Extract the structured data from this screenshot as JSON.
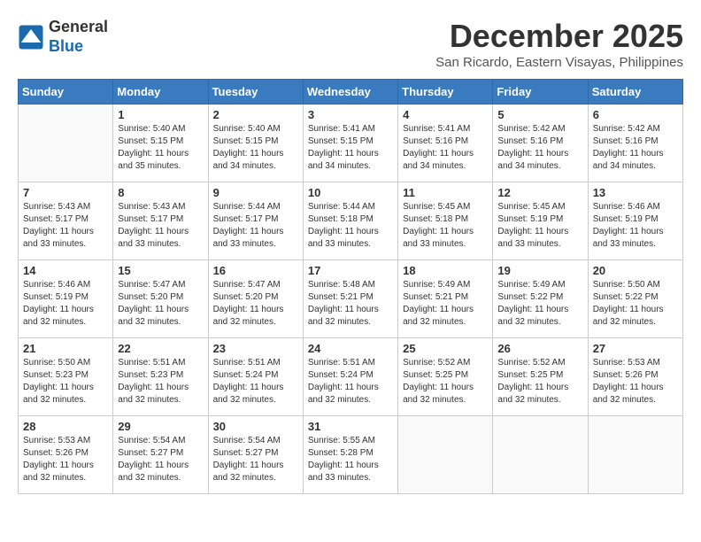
{
  "header": {
    "logo_line1": "General",
    "logo_line2": "Blue",
    "title": "December 2025",
    "subtitle": "San Ricardo, Eastern Visayas, Philippines"
  },
  "weekdays": [
    "Sunday",
    "Monday",
    "Tuesday",
    "Wednesday",
    "Thursday",
    "Friday",
    "Saturday"
  ],
  "weeks": [
    [
      {
        "day": "",
        "info": ""
      },
      {
        "day": "1",
        "info": "Sunrise: 5:40 AM\nSunset: 5:15 PM\nDaylight: 11 hours\nand 35 minutes."
      },
      {
        "day": "2",
        "info": "Sunrise: 5:40 AM\nSunset: 5:15 PM\nDaylight: 11 hours\nand 34 minutes."
      },
      {
        "day": "3",
        "info": "Sunrise: 5:41 AM\nSunset: 5:15 PM\nDaylight: 11 hours\nand 34 minutes."
      },
      {
        "day": "4",
        "info": "Sunrise: 5:41 AM\nSunset: 5:16 PM\nDaylight: 11 hours\nand 34 minutes."
      },
      {
        "day": "5",
        "info": "Sunrise: 5:42 AM\nSunset: 5:16 PM\nDaylight: 11 hours\nand 34 minutes."
      },
      {
        "day": "6",
        "info": "Sunrise: 5:42 AM\nSunset: 5:16 PM\nDaylight: 11 hours\nand 34 minutes."
      }
    ],
    [
      {
        "day": "7",
        "info": "Sunrise: 5:43 AM\nSunset: 5:17 PM\nDaylight: 11 hours\nand 33 minutes."
      },
      {
        "day": "8",
        "info": "Sunrise: 5:43 AM\nSunset: 5:17 PM\nDaylight: 11 hours\nand 33 minutes."
      },
      {
        "day": "9",
        "info": "Sunrise: 5:44 AM\nSunset: 5:17 PM\nDaylight: 11 hours\nand 33 minutes."
      },
      {
        "day": "10",
        "info": "Sunrise: 5:44 AM\nSunset: 5:18 PM\nDaylight: 11 hours\nand 33 minutes."
      },
      {
        "day": "11",
        "info": "Sunrise: 5:45 AM\nSunset: 5:18 PM\nDaylight: 11 hours\nand 33 minutes."
      },
      {
        "day": "12",
        "info": "Sunrise: 5:45 AM\nSunset: 5:19 PM\nDaylight: 11 hours\nand 33 minutes."
      },
      {
        "day": "13",
        "info": "Sunrise: 5:46 AM\nSunset: 5:19 PM\nDaylight: 11 hours\nand 33 minutes."
      }
    ],
    [
      {
        "day": "14",
        "info": "Sunrise: 5:46 AM\nSunset: 5:19 PM\nDaylight: 11 hours\nand 32 minutes."
      },
      {
        "day": "15",
        "info": "Sunrise: 5:47 AM\nSunset: 5:20 PM\nDaylight: 11 hours\nand 32 minutes."
      },
      {
        "day": "16",
        "info": "Sunrise: 5:47 AM\nSunset: 5:20 PM\nDaylight: 11 hours\nand 32 minutes."
      },
      {
        "day": "17",
        "info": "Sunrise: 5:48 AM\nSunset: 5:21 PM\nDaylight: 11 hours\nand 32 minutes."
      },
      {
        "day": "18",
        "info": "Sunrise: 5:49 AM\nSunset: 5:21 PM\nDaylight: 11 hours\nand 32 minutes."
      },
      {
        "day": "19",
        "info": "Sunrise: 5:49 AM\nSunset: 5:22 PM\nDaylight: 11 hours\nand 32 minutes."
      },
      {
        "day": "20",
        "info": "Sunrise: 5:50 AM\nSunset: 5:22 PM\nDaylight: 11 hours\nand 32 minutes."
      }
    ],
    [
      {
        "day": "21",
        "info": "Sunrise: 5:50 AM\nSunset: 5:23 PM\nDaylight: 11 hours\nand 32 minutes."
      },
      {
        "day": "22",
        "info": "Sunrise: 5:51 AM\nSunset: 5:23 PM\nDaylight: 11 hours\nand 32 minutes."
      },
      {
        "day": "23",
        "info": "Sunrise: 5:51 AM\nSunset: 5:24 PM\nDaylight: 11 hours\nand 32 minutes."
      },
      {
        "day": "24",
        "info": "Sunrise: 5:51 AM\nSunset: 5:24 PM\nDaylight: 11 hours\nand 32 minutes."
      },
      {
        "day": "25",
        "info": "Sunrise: 5:52 AM\nSunset: 5:25 PM\nDaylight: 11 hours\nand 32 minutes."
      },
      {
        "day": "26",
        "info": "Sunrise: 5:52 AM\nSunset: 5:25 PM\nDaylight: 11 hours\nand 32 minutes."
      },
      {
        "day": "27",
        "info": "Sunrise: 5:53 AM\nSunset: 5:26 PM\nDaylight: 11 hours\nand 32 minutes."
      }
    ],
    [
      {
        "day": "28",
        "info": "Sunrise: 5:53 AM\nSunset: 5:26 PM\nDaylight: 11 hours\nand 32 minutes."
      },
      {
        "day": "29",
        "info": "Sunrise: 5:54 AM\nSunset: 5:27 PM\nDaylight: 11 hours\nand 32 minutes."
      },
      {
        "day": "30",
        "info": "Sunrise: 5:54 AM\nSunset: 5:27 PM\nDaylight: 11 hours\nand 32 minutes."
      },
      {
        "day": "31",
        "info": "Sunrise: 5:55 AM\nSunset: 5:28 PM\nDaylight: 11 hours\nand 33 minutes."
      },
      {
        "day": "",
        "info": ""
      },
      {
        "day": "",
        "info": ""
      },
      {
        "day": "",
        "info": ""
      }
    ]
  ]
}
